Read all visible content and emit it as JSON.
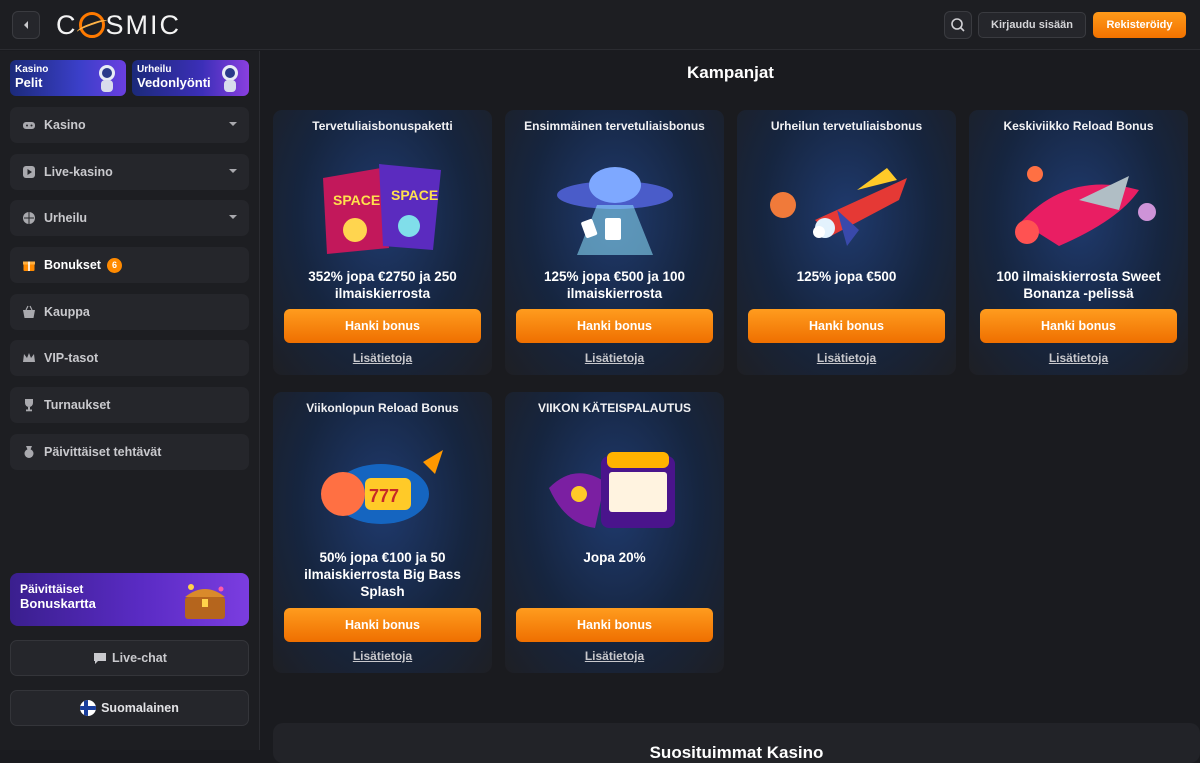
{
  "header": {
    "logo": "COSMIC",
    "login_label": "Kirjaudu sisään",
    "register_label": "Rekisteröidy"
  },
  "sidebar": {
    "promos": [
      {
        "small": "Kasino",
        "big": "Pelit"
      },
      {
        "small": "Urheilu",
        "big": "Vedonlyönti"
      }
    ],
    "items": [
      {
        "label": "Kasino",
        "icon": "gamepad-icon",
        "expandable": true
      },
      {
        "label": "Live-kasino",
        "icon": "play-icon",
        "expandable": true
      },
      {
        "label": "Urheilu",
        "icon": "ball-icon",
        "expandable": true
      },
      {
        "label": "Bonukset",
        "icon": "gift-icon",
        "badge": "6"
      },
      {
        "label": "Kauppa",
        "icon": "basket-icon"
      },
      {
        "label": "VIP-tasot",
        "icon": "crown-icon"
      },
      {
        "label": "Turnaukset",
        "icon": "trophy-icon"
      },
      {
        "label": "Päivittäiset tehtävät",
        "icon": "medal-icon"
      }
    ],
    "bonusmap": {
      "line1": "Päivittäiset",
      "line2": "Bonuskartta"
    },
    "live_chat": "Live-chat",
    "language": "Suomalainen"
  },
  "main": {
    "title": "Kampanjat",
    "cta_label": "Hanki bonus",
    "more_label": "Lisätietoja",
    "cards": [
      {
        "title": "Tervetuliaisbonuspaketti",
        "offer": "352% jopa €2750 ja 250 ilmaiskierrosta"
      },
      {
        "title": "Ensimmäinen tervetuliaisbonus",
        "offer": "125% jopa €500 ja 100 ilmaiskierrosta"
      },
      {
        "title": "Urheilun tervetuliaisbonus",
        "offer": "125% jopa €500"
      },
      {
        "title": "Keskiviikko Reload Bonus",
        "offer": "100 ilmaiskierrosta Sweet Bonanza -pelissä"
      },
      {
        "title": "Viikonlopun Reload Bonus",
        "offer": "50% jopa €100 ja 50 ilmaiskierrosta Big Bass Splash"
      },
      {
        "title": "VIIKON KÄTEISPALAUTUS",
        "offer": "Jopa 20%"
      }
    ],
    "bottom_title": "Suosituimmat Kasino"
  }
}
